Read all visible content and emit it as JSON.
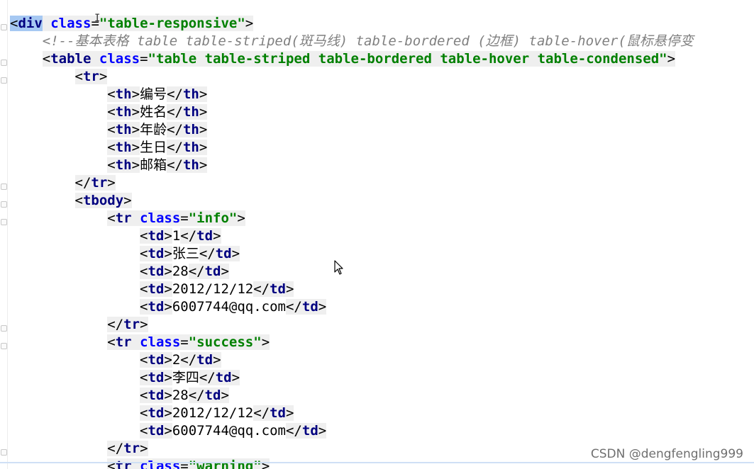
{
  "editor": {
    "lines": [
      {
        "indent": 0,
        "type": "open",
        "tag": "div",
        "attr": "class",
        "value": "table-responsive",
        "selected": true
      },
      {
        "indent": 1,
        "type": "comment",
        "text": "<!--基本表格 table table-striped(斑马线) table-bordered (边框) table-hover(鼠标悬停变"
      },
      {
        "indent": 1,
        "type": "open",
        "tag": "table",
        "attr": "class",
        "value": "table table-striped table-bordered table-hover table-condensed"
      },
      {
        "indent": 2,
        "type": "open",
        "tag": "tr"
      },
      {
        "indent": 3,
        "type": "elem",
        "tag": "th",
        "text": "编号"
      },
      {
        "indent": 3,
        "type": "elem",
        "tag": "th",
        "text": "姓名"
      },
      {
        "indent": 3,
        "type": "elem",
        "tag": "th",
        "text": "年龄"
      },
      {
        "indent": 3,
        "type": "elem",
        "tag": "th",
        "text": "生日"
      },
      {
        "indent": 3,
        "type": "elem",
        "tag": "th",
        "text": "邮箱"
      },
      {
        "indent": 2,
        "type": "close",
        "tag": "tr"
      },
      {
        "indent": 2,
        "type": "open",
        "tag": "tbody"
      },
      {
        "indent": 3,
        "type": "open",
        "tag": "tr",
        "attr": "class",
        "value": "info"
      },
      {
        "indent": 4,
        "type": "elem",
        "tag": "td",
        "text": "1"
      },
      {
        "indent": 4,
        "type": "elem",
        "tag": "td",
        "text": "张三"
      },
      {
        "indent": 4,
        "type": "elem",
        "tag": "td",
        "text": "28"
      },
      {
        "indent": 4,
        "type": "elem",
        "tag": "td",
        "text": "2012/12/12"
      },
      {
        "indent": 4,
        "type": "elem",
        "tag": "td",
        "text": "6007744@qq.com"
      },
      {
        "indent": 3,
        "type": "close",
        "tag": "tr"
      },
      {
        "indent": 3,
        "type": "open",
        "tag": "tr",
        "attr": "class",
        "value": "success"
      },
      {
        "indent": 4,
        "type": "elem",
        "tag": "td",
        "text": "2"
      },
      {
        "indent": 4,
        "type": "elem",
        "tag": "td",
        "text": "李四"
      },
      {
        "indent": 4,
        "type": "elem",
        "tag": "td",
        "text": "28"
      },
      {
        "indent": 4,
        "type": "elem",
        "tag": "td",
        "text": "2012/12/12"
      },
      {
        "indent": 4,
        "type": "elem",
        "tag": "td",
        "text": "6007744@qq.com"
      },
      {
        "indent": 3,
        "type": "close",
        "tag": "tr"
      },
      {
        "indent": 3,
        "type": "open",
        "tag": "tr",
        "attr": "class",
        "value": "warning"
      }
    ]
  },
  "watermark": "CSDN @dengfengling999",
  "colors": {
    "tag_name": "#000080",
    "attr_name": "#0000ff",
    "attr_value": "#008000",
    "comment": "#808080",
    "tag_background": "#efefef",
    "selection": "#a6c8f2"
  }
}
